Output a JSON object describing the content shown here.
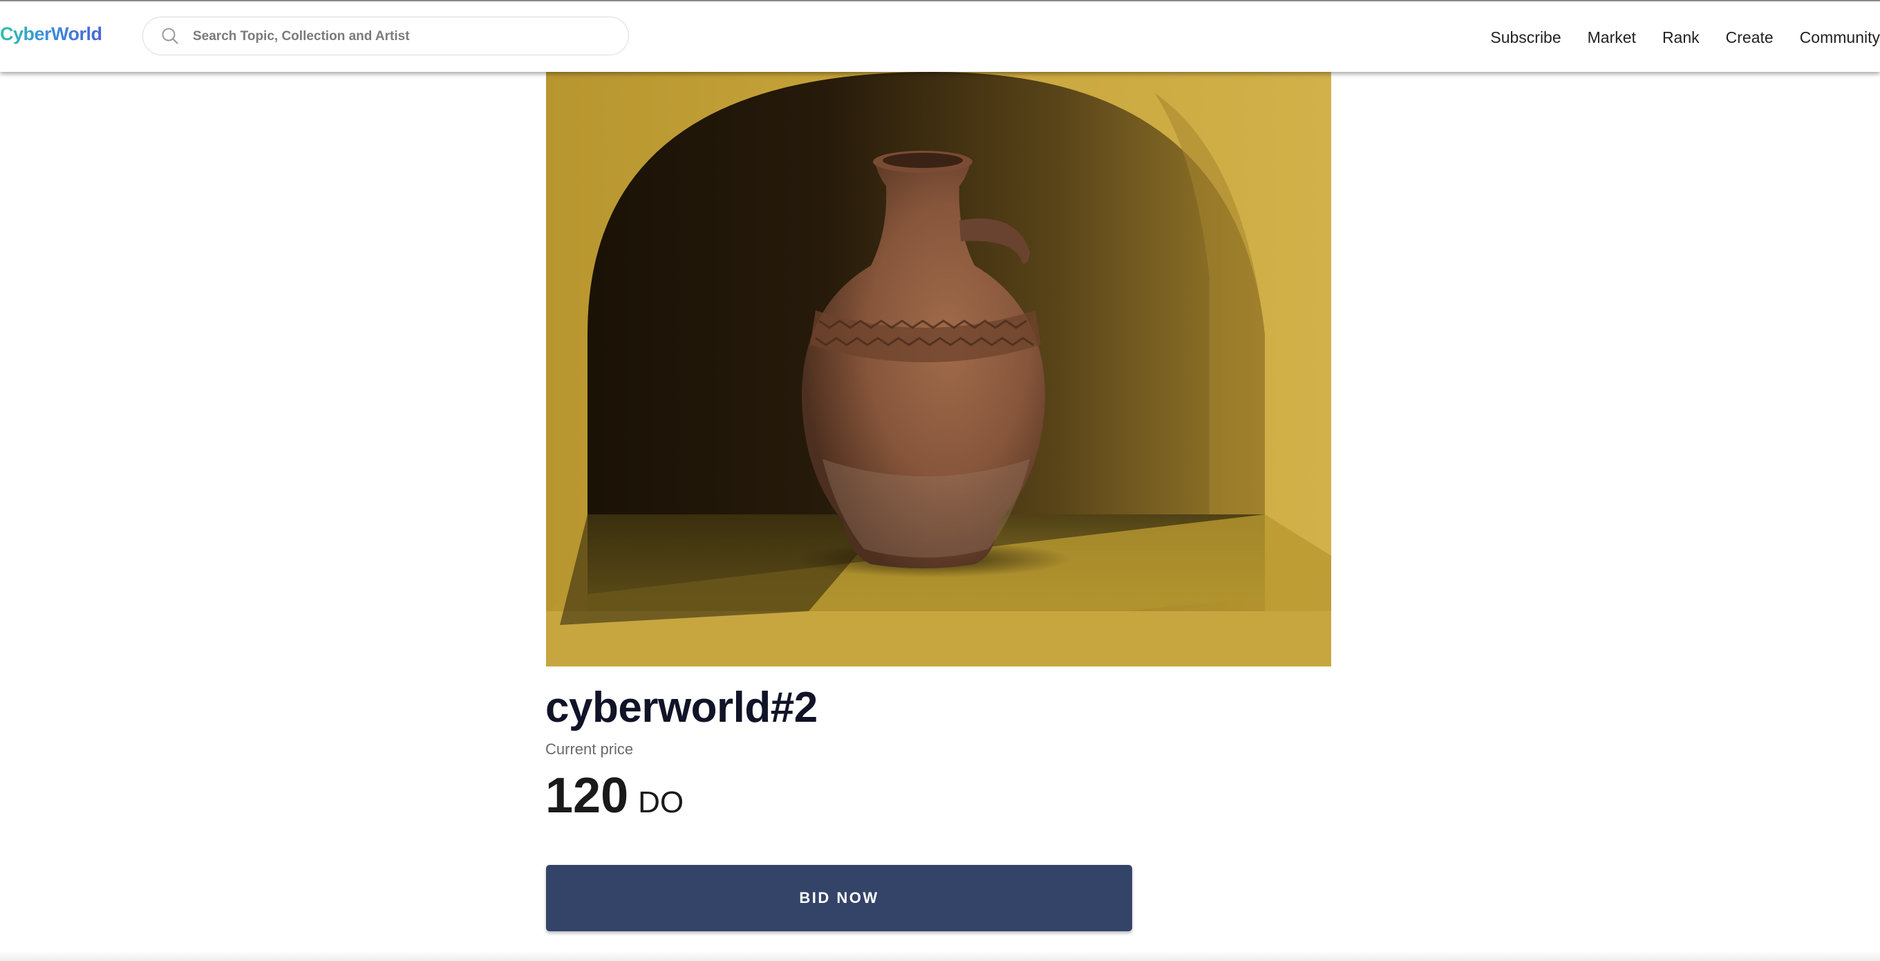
{
  "header": {
    "logo_text": "CyberWorld",
    "search": {
      "placeholder": "Search Topic, Collection and Artist",
      "value": ""
    },
    "nav": [
      {
        "label": "Subscribe"
      },
      {
        "label": "Market"
      },
      {
        "label": "Rank"
      },
      {
        "label": "Create"
      },
      {
        "label": "Community"
      }
    ]
  },
  "item": {
    "image_subject": "terracotta jug in yellow wall niche",
    "title": "cyberworld#2",
    "price_label": "Current price",
    "price_value": "120",
    "price_unit": "DO",
    "bid_label": "BID NOW"
  },
  "colors": {
    "button_bg": "#344469",
    "title_text": "#111428",
    "logo_gradient_start": "#2fc2a6",
    "logo_gradient_end": "#4a63d6",
    "niche_yellow": "#c8a43a",
    "jug_terracotta": "#8a5a3e"
  },
  "icons": {
    "search": "search-icon"
  }
}
